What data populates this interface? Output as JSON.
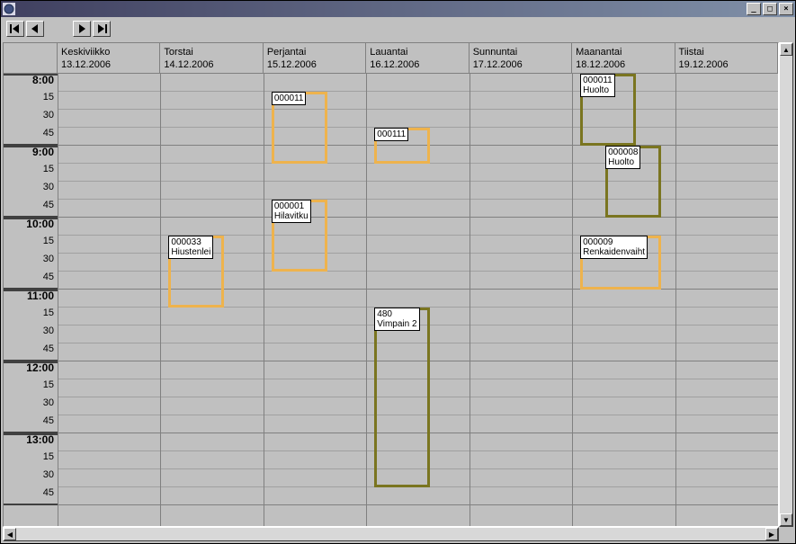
{
  "titlebar": {
    "title": ""
  },
  "window_controls": {
    "min": "_",
    "max": "□",
    "close": "×"
  },
  "toolbar": {
    "first": "first",
    "prev": "prev",
    "next": "next",
    "last": "last"
  },
  "days": [
    {
      "name": "Keskiviikko",
      "date": "13.12.2006"
    },
    {
      "name": "Torstai",
      "date": "14.12.2006"
    },
    {
      "name": "Perjantai",
      "date": "15.12.2006"
    },
    {
      "name": "Lauantai",
      "date": "16.12.2006"
    },
    {
      "name": "Sunnuntai",
      "date": "17.12.2006"
    },
    {
      "name": "Maanantai",
      "date": "18.12.2006"
    },
    {
      "name": "Tiistai",
      "date": "19.12.2006"
    }
  ],
  "time": {
    "hours": [
      "8:00",
      "9:00",
      "10:00",
      "11:00",
      "12:00",
      "13:00"
    ],
    "quarters": [
      "15",
      "30",
      "45"
    ]
  },
  "events": [
    {
      "day": 1,
      "start": 10.25,
      "end": 11.25,
      "code": "000033",
      "text": "Hiustenlei",
      "color": "orange"
    },
    {
      "day": 2,
      "start": 8.25,
      "end": 9.25,
      "code": "000011",
      "text": "",
      "color": "orange"
    },
    {
      "day": 2,
      "start": 9.75,
      "end": 10.75,
      "code": "000001",
      "text": "Hilavitku",
      "color": "orange"
    },
    {
      "day": 3,
      "start": 8.75,
      "end": 9.25,
      "code": "000111",
      "text": "",
      "color": "orange"
    },
    {
      "day": 3,
      "start": 11.25,
      "end": 13.75,
      "code": "480",
      "text": "Vimpain 2",
      "color": "olive"
    },
    {
      "day": 5,
      "start": 8.0,
      "end": 9.0,
      "code": "000011",
      "text": "Huolto",
      "color": "olive"
    },
    {
      "day": 5,
      "start": 9.0,
      "end": 10.0,
      "code": "000008",
      "text": "Huolto",
      "color": "olive",
      "offsetX": 28
    },
    {
      "day": 5,
      "start": 10.25,
      "end": 11.0,
      "code": "000009",
      "text": "Renkaidenvaiht",
      "color": "orange",
      "wide": true
    }
  ],
  "colors": {
    "orange": "#eeb34d",
    "olive": "#7a7520"
  }
}
